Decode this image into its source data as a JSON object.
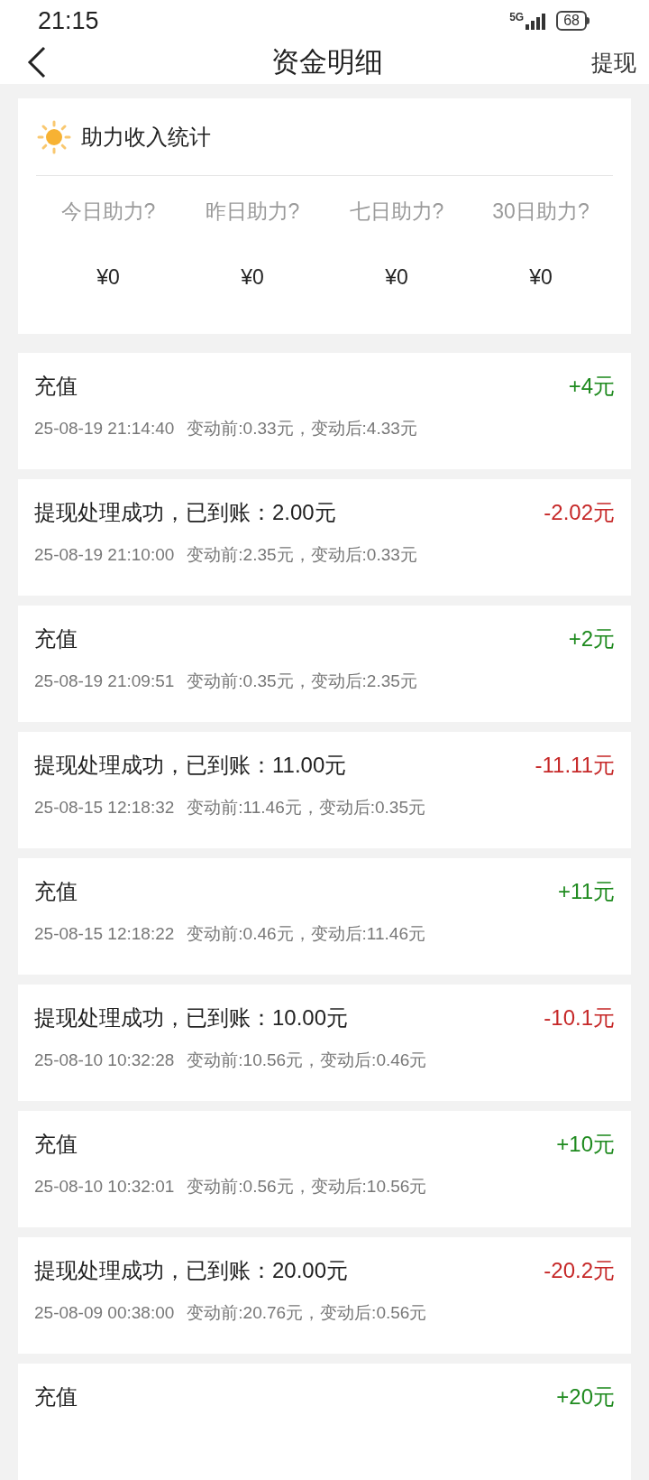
{
  "status_bar": {
    "time": "21:15",
    "network": "5G",
    "battery": "68"
  },
  "header": {
    "title": "资金明细",
    "action": "提现"
  },
  "stats": {
    "title": "助力收入统计",
    "items": [
      {
        "label": "今日助力?",
        "value": "¥0"
      },
      {
        "label": "昨日助力?",
        "value": "¥0"
      },
      {
        "label": "七日助力?",
        "value": "¥0"
      },
      {
        "label": "30日助力?",
        "value": "¥0"
      }
    ]
  },
  "records": [
    {
      "kind": "income",
      "title": "充值",
      "amount": "+4元",
      "time": "25-08-19 21:14:40",
      "detail": "变动前:0.33元，变动后:4.33元"
    },
    {
      "kind": "expense",
      "title": "提现处理成功，已到账：2.00元",
      "amount": "-2.02元",
      "time": "25-08-19 21:10:00",
      "detail": "变动前:2.35元，变动后:0.33元"
    },
    {
      "kind": "income",
      "title": "充值",
      "amount": "+2元",
      "time": "25-08-19 21:09:51",
      "detail": "变动前:0.35元，变动后:2.35元"
    },
    {
      "kind": "expense",
      "title": "提现处理成功，已到账：11.00元",
      "amount": "-11.11元",
      "time": "25-08-15 12:18:32",
      "detail": "变动前:11.46元，变动后:0.35元"
    },
    {
      "kind": "income",
      "title": "充值",
      "amount": "+11元",
      "time": "25-08-15 12:18:22",
      "detail": "变动前:0.46元，变动后:11.46元"
    },
    {
      "kind": "expense",
      "title": "提现处理成功，已到账：10.00元",
      "amount": "-10.1元",
      "time": "25-08-10 10:32:28",
      "detail": "变动前:10.56元，变动后:0.46元"
    },
    {
      "kind": "income",
      "title": "充值",
      "amount": "+10元",
      "time": "25-08-10 10:32:01",
      "detail": "变动前:0.56元，变动后:10.56元"
    },
    {
      "kind": "expense",
      "title": "提现处理成功，已到账：20.00元",
      "amount": "-20.2元",
      "time": "25-08-09 00:38:00",
      "detail": "变动前:20.76元，变动后:0.56元"
    },
    {
      "kind": "income",
      "title": "充值",
      "amount": "+20元"
    }
  ]
}
